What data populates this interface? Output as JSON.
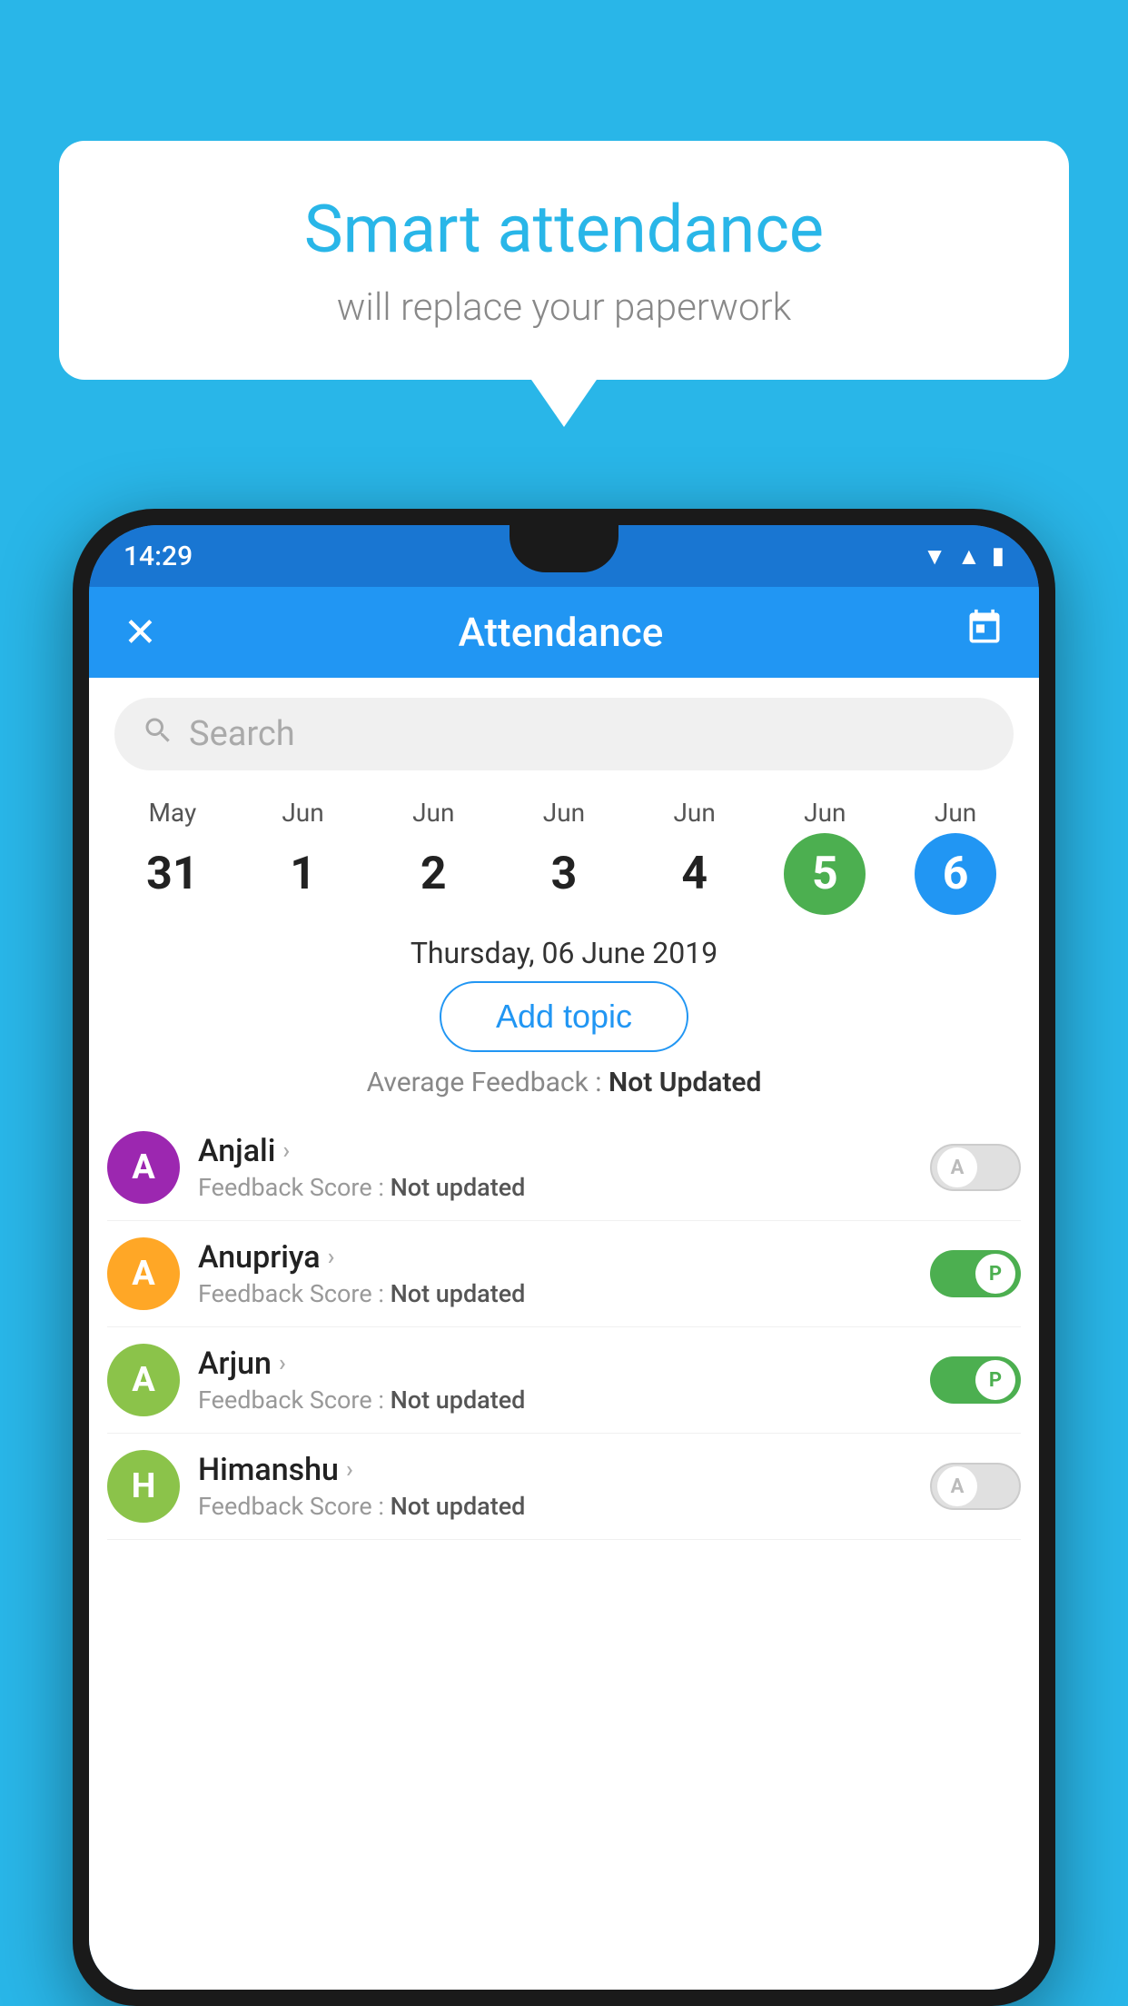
{
  "background_color": "#29b6e8",
  "bubble": {
    "title": "Smart attendance",
    "subtitle": "will replace your paperwork"
  },
  "status_bar": {
    "time": "14:29",
    "icons": [
      "wifi",
      "signal",
      "battery"
    ]
  },
  "app_bar": {
    "title": "Attendance",
    "close_icon": "✕",
    "calendar_icon": "📅"
  },
  "search": {
    "placeholder": "Search"
  },
  "calendar": {
    "days": [
      {
        "month": "May",
        "date": "31",
        "state": "normal"
      },
      {
        "month": "Jun",
        "date": "1",
        "state": "normal"
      },
      {
        "month": "Jun",
        "date": "2",
        "state": "normal"
      },
      {
        "month": "Jun",
        "date": "3",
        "state": "normal"
      },
      {
        "month": "Jun",
        "date": "4",
        "state": "normal"
      },
      {
        "month": "Jun",
        "date": "5",
        "state": "today"
      },
      {
        "month": "Jun",
        "date": "6",
        "state": "selected"
      }
    ],
    "selected_label": "Thursday, 06 June 2019"
  },
  "add_topic_label": "Add topic",
  "avg_feedback": {
    "label": "Average Feedback :",
    "value": "Not Updated"
  },
  "students": [
    {
      "name": "Anjali",
      "avatar_letter": "A",
      "avatar_color": "#9C27B0",
      "feedback_label": "Feedback Score :",
      "feedback_value": "Not updated",
      "toggle_state": "off",
      "toggle_letter": "A"
    },
    {
      "name": "Anupriya",
      "avatar_letter": "A",
      "avatar_color": "#FFA726",
      "feedback_label": "Feedback Score :",
      "feedback_value": "Not updated",
      "toggle_state": "on",
      "toggle_letter": "P"
    },
    {
      "name": "Arjun",
      "avatar_letter": "A",
      "avatar_color": "#8BC34A",
      "feedback_label": "Feedback Score :",
      "feedback_value": "Not updated",
      "toggle_state": "on",
      "toggle_letter": "P"
    },
    {
      "name": "Himanshu",
      "avatar_letter": "H",
      "avatar_color": "#8BC34A",
      "feedback_label": "Feedback Score :",
      "feedback_value": "Not updated",
      "toggle_state": "off",
      "toggle_letter": "A"
    }
  ]
}
